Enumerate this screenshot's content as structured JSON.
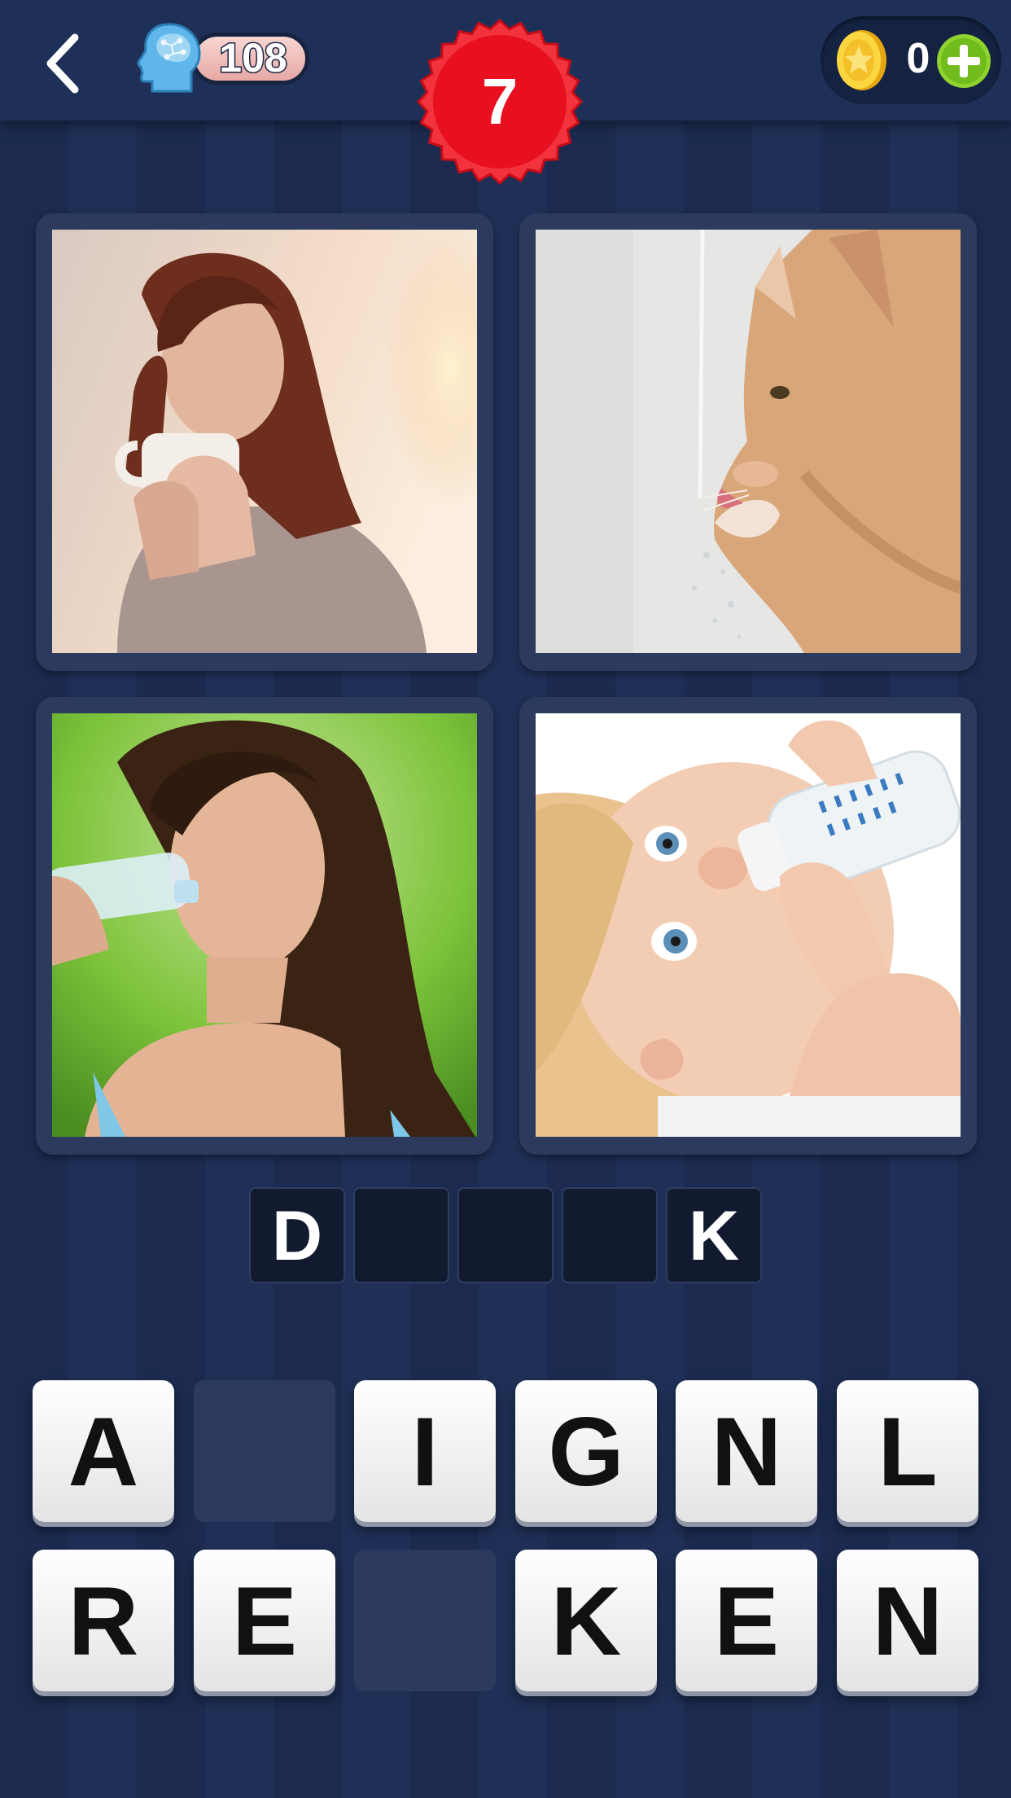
{
  "header": {
    "brain_count": "108",
    "level": "7",
    "coins": "0"
  },
  "puzzle": {
    "images": [
      {
        "icon": "woman-drinking-coffee-photo"
      },
      {
        "icon": "cat-drinking-water-photo"
      },
      {
        "icon": "woman-drinking-bottle-water-photo"
      },
      {
        "icon": "baby-drinking-bottle-photo"
      }
    ],
    "answer_slots": [
      "D",
      "",
      "",
      "",
      "K"
    ]
  },
  "keyboard": {
    "row1": [
      "A",
      "",
      "I",
      "G",
      "N",
      "L"
    ],
    "row2": [
      "R",
      "E",
      "",
      "K",
      "E",
      "N"
    ]
  },
  "colors": {
    "background": "#1b2a4e",
    "level_badge": "#e8101e",
    "add_button": "#7cc521",
    "coin": "#f5c518"
  }
}
